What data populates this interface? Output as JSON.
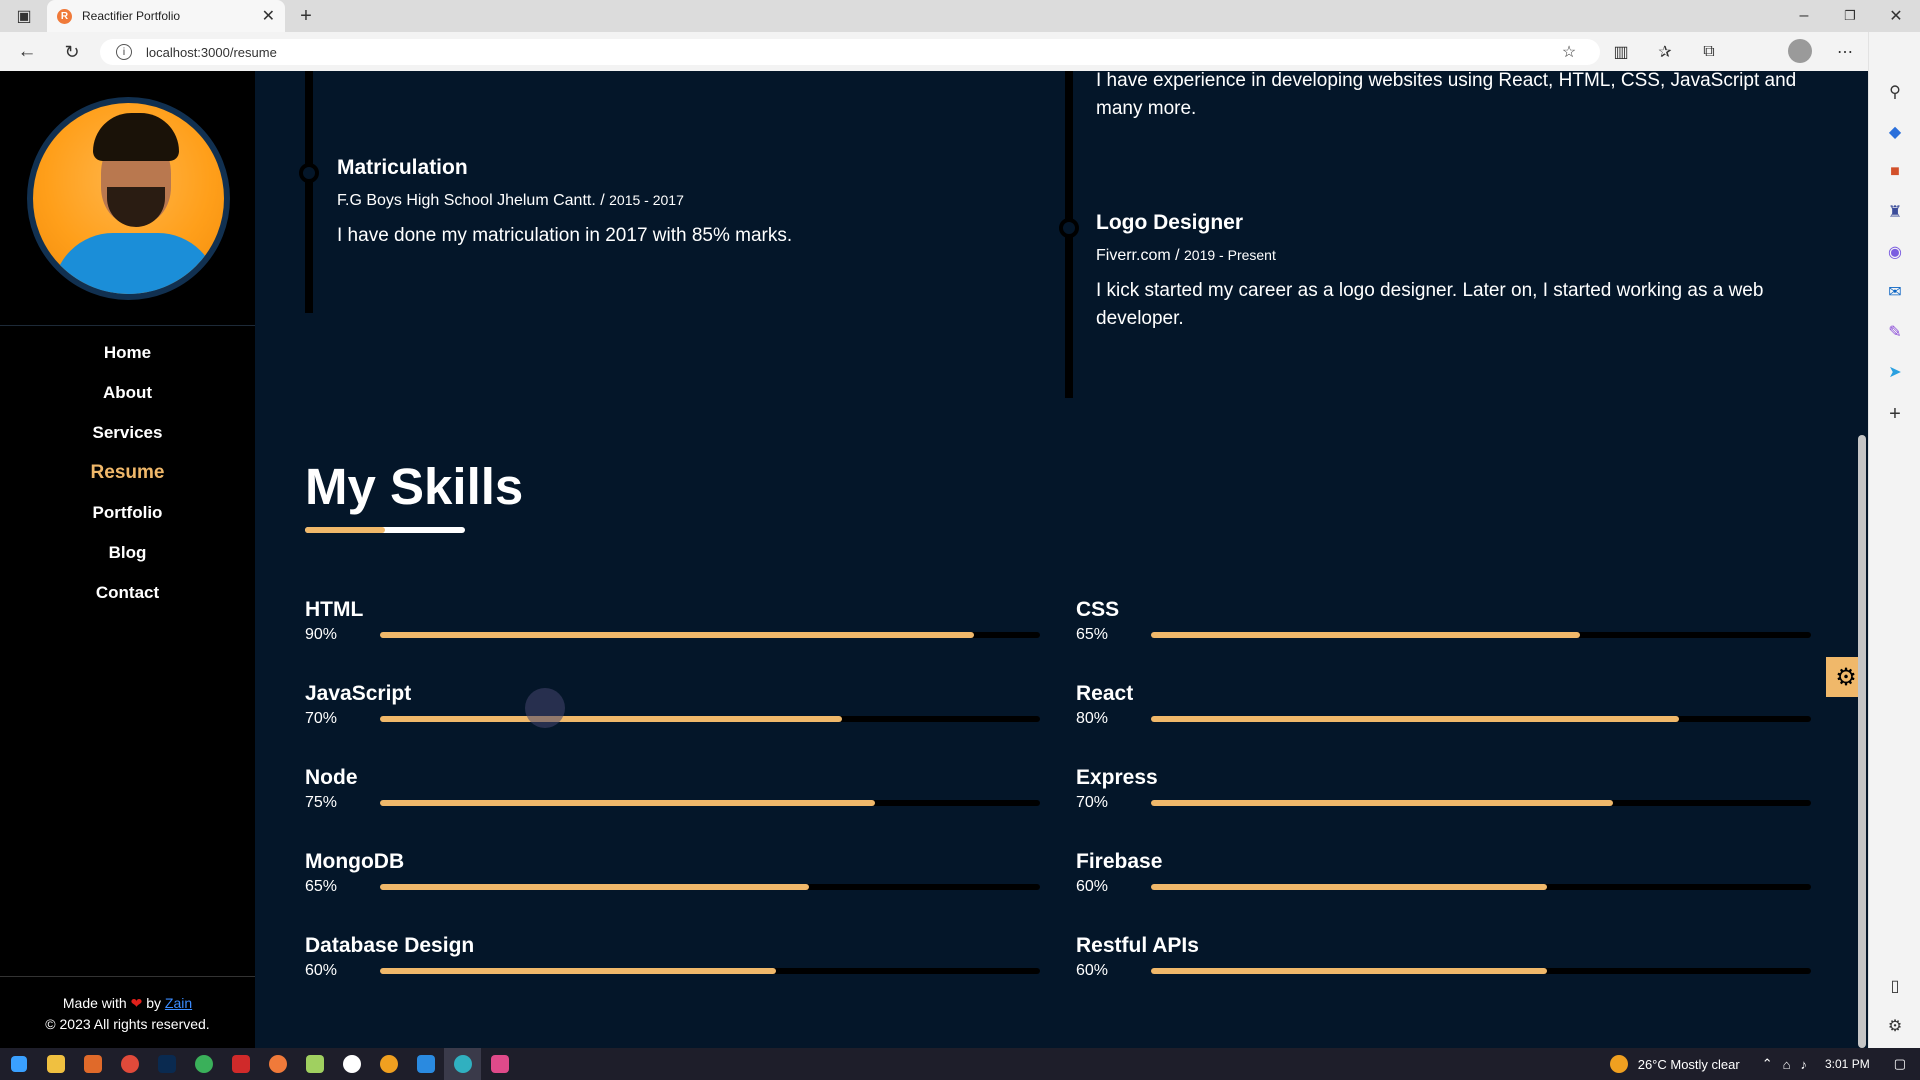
{
  "browser": {
    "tab_title": "Reactifier Portfolio",
    "favicon_letter": "R",
    "url": "localhost:3000/resume"
  },
  "sidebar": {
    "nav": [
      {
        "label": "Home"
      },
      {
        "label": "About"
      },
      {
        "label": "Services"
      },
      {
        "label": "Resume"
      },
      {
        "label": "Portfolio"
      },
      {
        "label": "Blog"
      },
      {
        "label": "Contact"
      }
    ],
    "footer": {
      "made_with": "Made with",
      "by": "by",
      "author": "Zain",
      "copyright": "© 2023 All rights reserved."
    }
  },
  "education": {
    "title": "Matriculation",
    "institute": "F.G Boys High School Jhelum Cantt.",
    "years": "2015 - 2017",
    "description": "I have done my matriculation in 2017 with 85% marks."
  },
  "experience": {
    "intro": "I have experience in developing websites using React, HTML, CSS, JavaScript and many more.",
    "title": "Logo Designer",
    "company": "Fiverr.com",
    "years": "2019 - Present",
    "description": "I kick started my career as a logo designer. Later on, I started working as a web developer."
  },
  "skills": {
    "heading": "My Skills",
    "items": [
      {
        "name": "HTML",
        "percent": "90%",
        "value": 90
      },
      {
        "name": "CSS",
        "percent": "65%",
        "value": 65
      },
      {
        "name": "JavaScript",
        "percent": "70%",
        "value": 70
      },
      {
        "name": "React",
        "percent": "80%",
        "value": 80
      },
      {
        "name": "Node",
        "percent": "75%",
        "value": 75
      },
      {
        "name": "Express",
        "percent": "70%",
        "value": 70
      },
      {
        "name": "MongoDB",
        "percent": "65%",
        "value": 65
      },
      {
        "name": "Firebase",
        "percent": "60%",
        "value": 60
      },
      {
        "name": "Database Design",
        "percent": "60%",
        "value": 60
      },
      {
        "name": "Restful APIs",
        "percent": "60%",
        "value": 60
      }
    ]
  },
  "taskbar": {
    "weather": "26°C  Mostly clear",
    "time": "3:01 PM"
  },
  "colors": {
    "accent": "#f0b86a",
    "background": "#041629"
  }
}
